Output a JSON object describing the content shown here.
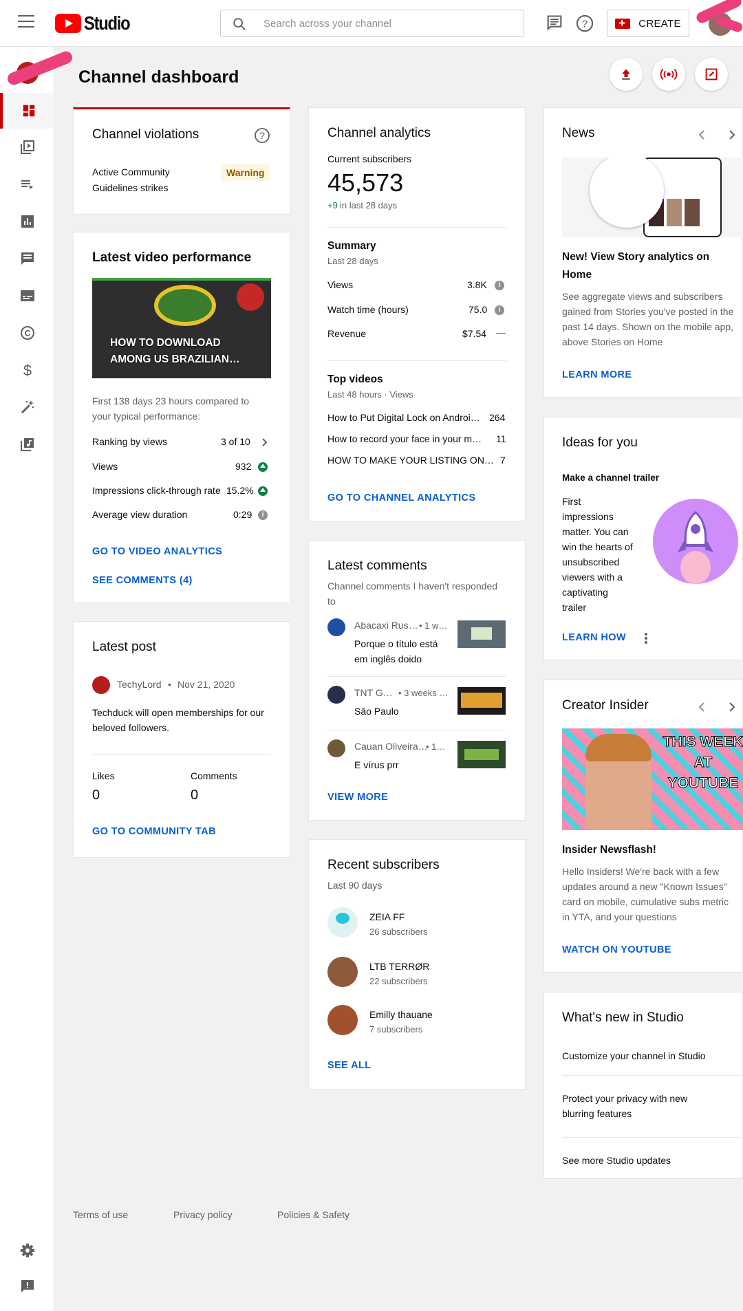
{
  "header": {
    "logo_text": "Studio",
    "search_placeholder": "Search across your channel",
    "create_label": "CREATE"
  },
  "page": {
    "title": "Channel dashboard"
  },
  "violations": {
    "title": "Channel violations",
    "label": "Active Community Guidelines strikes",
    "label_l1": "Active Community",
    "label_l2": "Guidelines strikes",
    "badge": "Warning"
  },
  "latest_video": {
    "title": "Latest video performance",
    "thumb_text_l1": "HOW TO DOWNLOAD",
    "thumb_text_l2": "AMONG US BRAZILIAN…",
    "compare_l1": "First 138 days 23 hours compared to",
    "compare_l2": "your typical performance:",
    "rows": [
      {
        "label": "Ranking by views",
        "value": "3 of 10"
      },
      {
        "label": "Views",
        "value": "932"
      },
      {
        "label": "Impressions click-through rate",
        "value": "15.2%"
      },
      {
        "label": "Average view duration",
        "value": "0:29"
      }
    ],
    "link_analytics": "GO TO VIDEO ANALYTICS",
    "link_comments": "SEE COMMENTS (4)"
  },
  "latest_post": {
    "title": "Latest post",
    "author": "TechyLord",
    "date": "Nov 21, 2020",
    "text_l1": "Techduck will open memberships for our",
    "text_l2": "beloved followers.",
    "likes_label": "Likes",
    "likes": "0",
    "comments_label": "Comments",
    "comments": "0",
    "link": "GO TO COMMUNITY TAB"
  },
  "analytics": {
    "title": "Channel analytics",
    "subs_label": "Current subscribers",
    "subs": "45,573",
    "subs_change": "+9",
    "subs_change_period": "in last 28 days",
    "summary_title": "Summary",
    "summary_period": "Last 28 days",
    "summary": [
      {
        "label": "Views",
        "value": "3.8K"
      },
      {
        "label": "Watch time (hours)",
        "value": "75.0"
      },
      {
        "label": "Revenue",
        "value": "$7.54"
      }
    ],
    "revenue_trend": "—",
    "top_title": "Top videos",
    "top_period": "Last 48 hours · Views",
    "top_videos": [
      {
        "title": "How to Put Digital Lock on Androi…",
        "views": "264"
      },
      {
        "title": "How to record your face in your m…",
        "views": "11"
      },
      {
        "title": "HOW TO MAKE YOUR LISTING ON…",
        "views": "7"
      }
    ],
    "link": "GO TO CHANNEL ANALYTICS"
  },
  "comments": {
    "title": "Latest comments",
    "subtitle_l1": "Channel comments I haven't responded",
    "subtitle_l2": "to",
    "items": [
      {
        "author": "Abacaxi Rus…",
        "time": "• 1 w…",
        "text_l1": "Porque o título está",
        "text_l2": "em inglês doido"
      },
      {
        "author": "TNT G…",
        "time": "• 3 weeks …",
        "text_l1": "São Paulo",
        "text_l2": ""
      },
      {
        "author": "Cauan Oliveira…",
        "time": "• 1…",
        "text_l1": "E vírus prr",
        "text_l2": ""
      }
    ],
    "link": "VIEW MORE"
  },
  "subscribers": {
    "title": "Recent subscribers",
    "period": "Last 90 days",
    "items": [
      {
        "name": "ZEIA FF",
        "count": "26 subscribers"
      },
      {
        "name": "LTB TERRØR",
        "count": "22 subscribers"
      },
      {
        "name": "Emilly thauane",
        "count": "7 subscribers"
      }
    ],
    "link": "SEE ALL"
  },
  "news": {
    "title": "News",
    "headline_l1": "New! View Story analytics on",
    "headline_l2": "Home",
    "body": [
      "See aggregate views and subscribers",
      "gained from Stories you've posted in the",
      "past 14 days. Shown on the mobile app,",
      "above Stories on Home"
    ],
    "link": "LEARN MORE"
  },
  "ideas": {
    "title": "Ideas for you",
    "subtitle": "Make a channel trailer",
    "body": [
      "First",
      "impressions",
      "matter. You can",
      "win the hearts of",
      "unsubscribed",
      "viewers with a",
      "captivating",
      "trailer"
    ],
    "link": "LEARN HOW"
  },
  "insider": {
    "title": "Creator Insider",
    "thumb_l1": "THIS WEEK",
    "thumb_l2": "AT",
    "thumb_l3": "YOUTUBE",
    "headline": "Insider Newsflash!",
    "body": [
      "Hello Insiders! We're back with a few",
      "updates around a new \"Known Issues\"",
      "card on mobile, cumulative subs metric",
      "in YTA, and your questions"
    ],
    "link": "WATCH ON YOUTUBE"
  },
  "whats_new": {
    "title": "What's new in Studio",
    "items": [
      {
        "l1": "Customize your channel in Studio",
        "l2": ""
      },
      {
        "l1": "Protect your privacy with new",
        "l2": "blurring features"
      },
      {
        "l1": "See more Studio updates",
        "l2": ""
      }
    ]
  },
  "footer": {
    "terms": "Terms of use",
    "privacy": "Privacy policy",
    "policies": "Policies & Safety"
  },
  "colors": {
    "accent": "#cc0000",
    "link": "#065fd4",
    "positive": "#0b8043",
    "warning_bg": "#fef7e0"
  }
}
